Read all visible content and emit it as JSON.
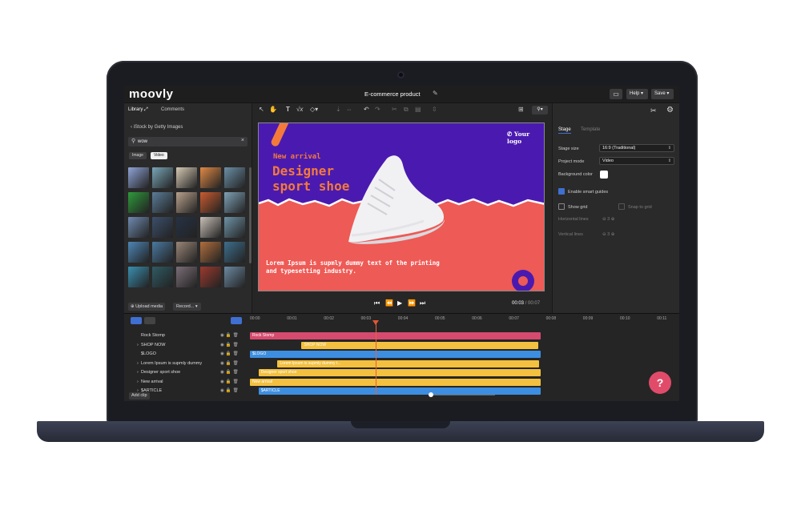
{
  "app": {
    "brand": "moovly",
    "project_title": "E-commerce product",
    "help_label": "Help",
    "save_label": "Save"
  },
  "library": {
    "tab_library": "Library",
    "tab_comments": "Comments",
    "source": "iStock by Getty Images",
    "search_value": "wow",
    "filter_image": "Image",
    "filter_video": "Video",
    "upload_label": "Upload media",
    "record_label": "Record..."
  },
  "stage_content": {
    "logo_text": "Your logo",
    "headline_small": "New arrival",
    "headline_1": "Designer",
    "headline_2": "sport shoe",
    "body_1": "Lorem Ipsum is supmly dummy text of the printing",
    "body_2": "and typesetting industry."
  },
  "player": {
    "current_time": "00:03",
    "separator": " / ",
    "total_time": "00:07"
  },
  "properties": {
    "tab_stage": "Stage",
    "tab_template": "Template",
    "stage_size_label": "Stage size",
    "stage_size_value": "16:9 (Traditional)",
    "project_mode_label": "Project mode",
    "project_mode_value": "Video",
    "background_color_label": "Background color",
    "smart_guides_label": "Enable smart guides",
    "show_grid_label": "Show grid",
    "snap_to_grid_label": "Snap to grid",
    "horizontal_lines_label": "Horizontal lines",
    "vertical_lines_label": "Vertical lines",
    "horizontal_lines_value": "3",
    "vertical_lines_value": "3"
  },
  "timeline": {
    "ticks": [
      "00:00",
      "00:01",
      "00:02",
      "00:03",
      "00:04",
      "00:05",
      "00:06",
      "00:07",
      "00:08",
      "00:09",
      "00:10",
      "00:11"
    ],
    "layers": [
      {
        "name": "Rock Stomp",
        "expand": "",
        "clip": "Rock Stomp",
        "color": "#d64a6e",
        "start": 0,
        "end": 8
      },
      {
        "name": "SHOP NOW",
        "expand": "›",
        "clip": "SHOP NOW",
        "color": "#f3c03f",
        "start": 1.5,
        "end": 8
      },
      {
        "name": "$LOGO",
        "expand": "",
        "clip": "$LOGO",
        "color": "#3d8ee0",
        "start": 0,
        "end": 8
      },
      {
        "name": "Lorem Ipsum is supmly dummy",
        "expand": "›",
        "clip": "Lorem Ipsum is supmly dummy t...",
        "color": "#f3c03f",
        "start": 0.8,
        "end": 8
      },
      {
        "name": "Designer sport shoe",
        "expand": "›",
        "clip": "Designer sport shoe",
        "color": "#f3c03f",
        "start": 0.25,
        "end": 8
      },
      {
        "name": "New arrival",
        "expand": "›",
        "clip": "New arrival",
        "color": "#f3c03f",
        "start": 0,
        "end": 8
      },
      {
        "name": "$ARTICLE",
        "expand": "›",
        "clip": "$ARTICLE",
        "color": "#3d8ee0",
        "start": 0.25,
        "end": 8
      }
    ],
    "add_clip_label": "Add clip"
  },
  "help_bubble": "?",
  "colors": {
    "accent_blue": "#3f6fd1",
    "stage_purple": "#4a1ab0",
    "stage_coral": "#ee5a55",
    "stage_orange": "#f47a3b",
    "help_pink": "#e14b6a"
  }
}
